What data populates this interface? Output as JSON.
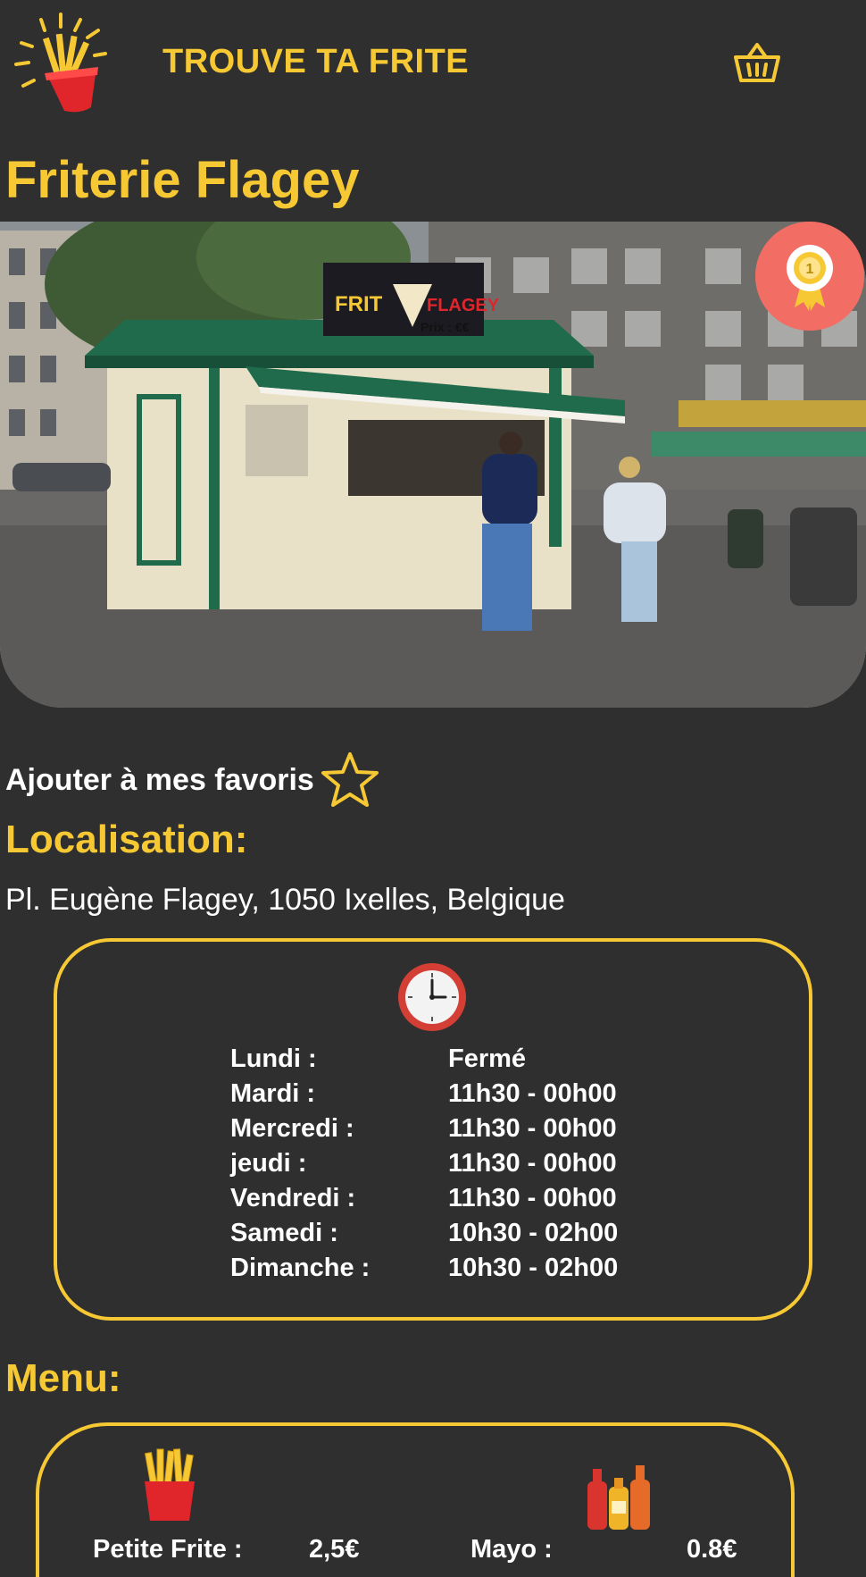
{
  "header": {
    "app_title": "TROUVE TA FRITE",
    "logo_icon": "fries-cup-logo-icon",
    "basket_icon": "basket-icon"
  },
  "place": {
    "name": "Friterie Flagey",
    "photo_price": "Prix : €€",
    "photo_sign_text": "FRIT FLAGEY",
    "rank_badge": "1"
  },
  "favorite": {
    "label": "Ajouter à mes favoris",
    "icon": "star-outline-icon"
  },
  "location": {
    "title": "Localisation:",
    "address": "Pl. Eugène Flagey, 1050 Ixelles, Belgique"
  },
  "hours": {
    "icon": "clock-icon",
    "rows": [
      {
        "day": "Lundi :",
        "time": "Fermé"
      },
      {
        "day": "Mardi :",
        "time": "11h30 - 00h00"
      },
      {
        "day": "Mercredi :",
        "time": "11h30 - 00h00"
      },
      {
        "day": "jeudi :",
        "time": "11h30 - 00h00"
      },
      {
        "day": "Vendredi :",
        "time": "11h30 - 00h00"
      },
      {
        "day": "Samedi :",
        "time": "10h30 - 02h00"
      },
      {
        "day": "Dimanche :",
        "time": "10h30 - 02h00"
      }
    ]
  },
  "menu": {
    "title": "Menu:",
    "fries_icon": "fries-icon",
    "sauce_icon": "sauce-bottles-icon",
    "fries_items": [
      {
        "name": "Petite Frite :",
        "price": "2,5€"
      }
    ],
    "sauce_items": [
      {
        "name": "Mayo :",
        "price": "0.8€"
      }
    ]
  },
  "colors": {
    "background": "#2f2f2f",
    "accent": "#f6c934",
    "badge": "#f26d63"
  }
}
